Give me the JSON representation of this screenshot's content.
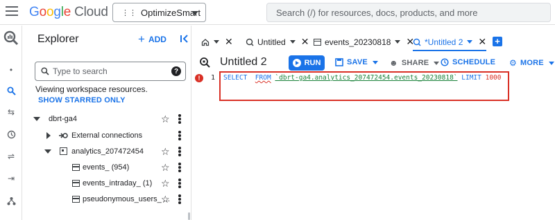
{
  "topbar": {
    "logo_parts": [
      "G",
      "o",
      "o",
      "g",
      "l",
      "e"
    ],
    "logo_product": "Cloud",
    "project_name": "OptimizeSmart",
    "search_placeholder": "Search (/) for resources, docs, products, and more"
  },
  "explorer": {
    "title": "Explorer",
    "add_label": "ADD",
    "search_placeholder": "Type to search",
    "info_text": "Viewing workspace resources.",
    "starred_label": "SHOW STARRED ONLY",
    "tree": [
      {
        "label": "dbrt-ga4",
        "level": 0,
        "expanded": true
      },
      {
        "label": "External connections",
        "level": 1,
        "expanded": false
      },
      {
        "label": "analytics_207472454",
        "level": 1,
        "expanded": true
      },
      {
        "label": "events_ (954)",
        "level": 2
      },
      {
        "label": "events_intraday_ (1)",
        "level": 2
      },
      {
        "label": "pseudonymous_users_ ...",
        "level": 2
      }
    ]
  },
  "tabs": [
    {
      "label": "",
      "icon": "home-icon"
    },
    {
      "label": "Untitled",
      "icon": "query-icon"
    },
    {
      "label": "events_20230818",
      "icon": "table-icon"
    },
    {
      "label": "*Untitled 2",
      "icon": "query-icon",
      "active": true
    }
  ],
  "editor": {
    "title": "Untitled 2",
    "run_label": "RUN",
    "save_label": "SAVE",
    "share_label": "SHARE",
    "schedule_label": "SCHEDULE",
    "more_label": "MORE",
    "line_number": "1",
    "code": {
      "select": "SELECT",
      "from": "FROM",
      "table": "`dbrt-ga4.analytics_207472454.events_20230818`",
      "limit": "LIMIT",
      "limit_value": "1000"
    }
  },
  "colors": {
    "accent": "#1a73e8",
    "error": "#d93025",
    "string": "#188038"
  }
}
